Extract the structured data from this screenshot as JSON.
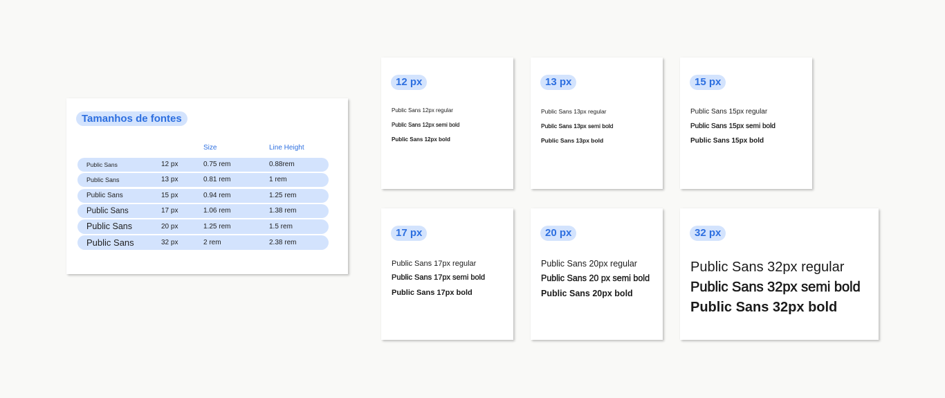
{
  "table": {
    "title": "Tamanhos de fontes",
    "header_size": "Size",
    "header_line_height": "Line Height",
    "rows": [
      {
        "font": "Public Sans",
        "px": "12 px",
        "rem": "0.75 rem",
        "lh": "0.88rem"
      },
      {
        "font": "Public Sans",
        "px": "13 px",
        "rem": "0.81 rem",
        "lh": "1 rem"
      },
      {
        "font": "Public Sans",
        "px": "15 px",
        "rem": "0.94 rem",
        "lh": "1.25 rem"
      },
      {
        "font": "Public Sans",
        "px": "17 px",
        "rem": "1.06 rem",
        "lh": "1.38 rem"
      },
      {
        "font": "Public Sans",
        "px": "20 px",
        "rem": "1.25 rem",
        "lh": "1.5 rem"
      },
      {
        "font": "Public Sans",
        "px": "32 px",
        "rem": "2 rem",
        "lh": "2.38 rem"
      }
    ]
  },
  "samples": [
    {
      "label": "12 px",
      "regular": "Public Sans 12px regular",
      "semibold": "Public Sans 12px semi bold",
      "bold": "Public Sans 12px bold"
    },
    {
      "label": "13 px",
      "regular": "Public Sans 13px regular",
      "semibold": "Public Sans 13px semi bold",
      "bold": "Public Sans 13px bold"
    },
    {
      "label": "15 px",
      "regular": "Public Sans 15px regular",
      "semibold": "Public Sans 15px semi bold",
      "bold": "Public Sans 15px bold"
    },
    {
      "label": "17 px",
      "regular": "Public Sans 17px regular",
      "semibold": "Public Sans 17px semi bold",
      "bold": "Public Sans 17px bold"
    },
    {
      "label": "20 px",
      "regular": "Public Sans 20px regular",
      "semibold": "Public Sans 20 px semi bold",
      "bold": "Public Sans 20px bold"
    },
    {
      "label": "32 px",
      "regular": "Public Sans 32px regular",
      "semibold": "Public Sans 32px semi bold",
      "bold": "Public Sans 32px bold"
    }
  ],
  "colors": {
    "accent": "#2d6fe0",
    "pill_background": "#d3e3fd",
    "page_background": "#f9f9f7",
    "card_background": "#ffffff"
  }
}
